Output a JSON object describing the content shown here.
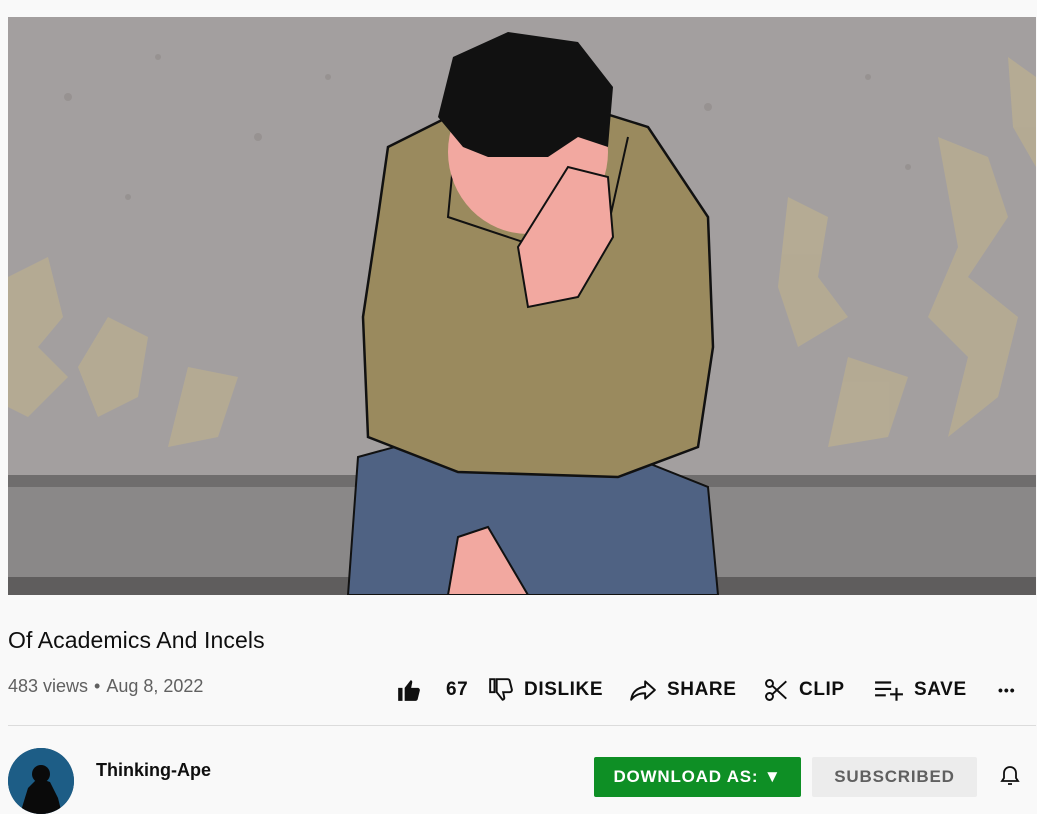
{
  "video": {
    "title": "Of Academics And Incels",
    "views": "483 views",
    "separator": "•",
    "date": "Aug 8, 2022"
  },
  "actions": {
    "like_count": "67",
    "dislike_label": "DISLIKE",
    "share_label": "SHARE",
    "clip_label": "CLIP",
    "save_label": "SAVE",
    "more_label": "•••"
  },
  "channel": {
    "name": "Thinking-Ape",
    "download_label": "DOWNLOAD AS: ▼",
    "subscribe_label": "SUBSCRIBED"
  },
  "icons": [
    "thumb-up-icon",
    "thumb-down-icon",
    "share-arrow-icon",
    "scissors-icon",
    "playlist-add-icon",
    "more-horiz-icon",
    "bell-icon"
  ],
  "colors": {
    "download_bg": "#0e8f25",
    "subscribed_bg": "#ececec",
    "background": "#f9f9f9"
  }
}
